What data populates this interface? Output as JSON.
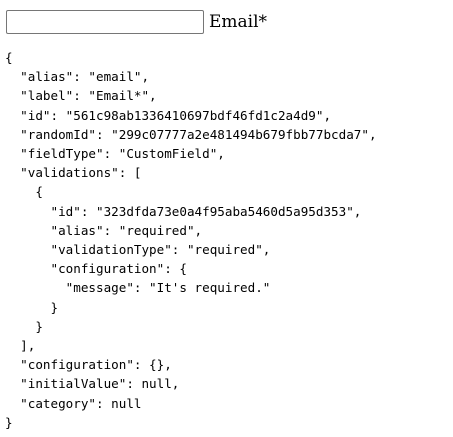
{
  "form": {
    "email_input_value": "",
    "email_label": "Email*"
  },
  "json_dump": {
    "text": "{\n  \"alias\": \"email\",\n  \"label\": \"Email*\",\n  \"id\": \"561c98ab1336410697bdf46fd1c2a4d9\",\n  \"randomId\": \"299c07777a2e481494b679fbb77bcda7\",\n  \"fieldType\": \"CustomField\",\n  \"validations\": [\n    {\n      \"id\": \"323dfda73e0a4f95aba5460d5a95d353\",\n      \"alias\": \"required\",\n      \"validationType\": \"required\",\n      \"configuration\": {\n        \"message\": \"It's required.\"\n      }\n    }\n  ],\n  \"configuration\": {},\n  \"initialValue\": null,\n  \"category\": null\n}"
  }
}
